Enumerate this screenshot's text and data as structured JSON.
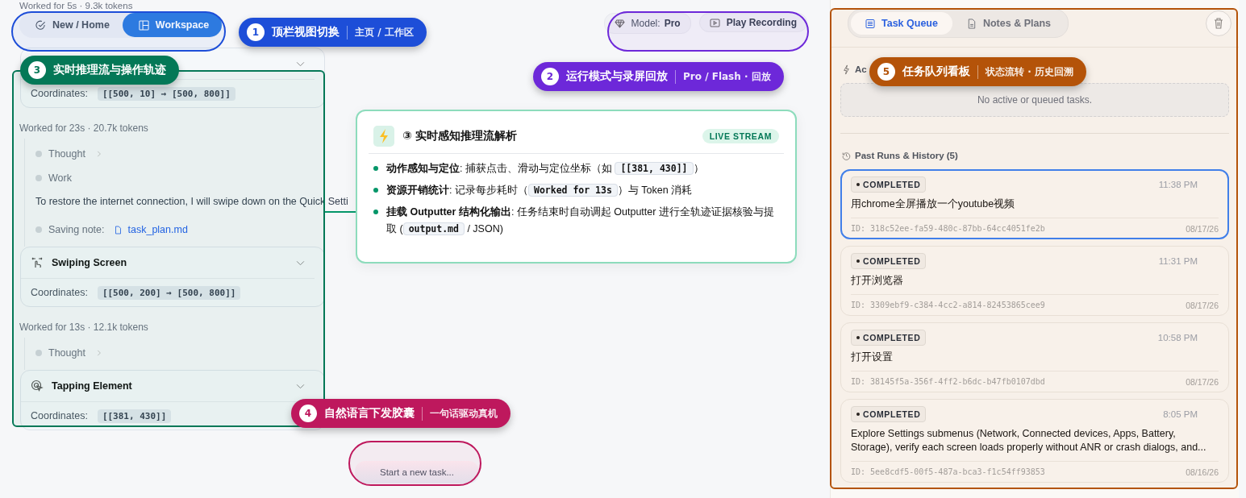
{
  "view_switch": {
    "tabs": [
      {
        "label": "New / Home",
        "selected": false
      },
      {
        "label": "Workspace",
        "selected": true
      }
    ]
  },
  "run_controls": {
    "model_label": "Model:",
    "model_value": "Pro",
    "play_label": "Play Recording"
  },
  "stream": [
    {
      "kind": "meta",
      "text": "Worked for 5s · 9.3k tokens"
    },
    {
      "kind": "action",
      "coords_label": "Coordinates:",
      "coords": "[[500, 10] → [500, 800]]"
    },
    {
      "kind": "meta",
      "text": "Worked for 23s · 20.7k tokens"
    },
    {
      "kind": "steps",
      "items": [
        {
          "kind": "step",
          "label": "Thought",
          "chevron": true
        },
        {
          "kind": "step",
          "label": "Work",
          "chevron": false
        },
        {
          "kind": "text",
          "text": "To restore the internet connection, I will swipe down on the Quick Setti"
        },
        {
          "kind": "note",
          "label": "Saving note:",
          "file": "task_plan.md"
        }
      ]
    },
    {
      "kind": "swipe_action",
      "title": "Swiping Screen",
      "coords_label": "Coordinates:",
      "coords": "[[500, 200] → [500, 800]]"
    },
    {
      "kind": "meta",
      "text": "Worked for 13s · 12.1k tokens"
    },
    {
      "kind": "steps",
      "items": [
        {
          "kind": "step",
          "label": "Thought",
          "chevron": true
        }
      ]
    },
    {
      "kind": "tap_action",
      "title": "Tapping Element",
      "coords_label": "Coordinates:",
      "coords": "[[381, 430]]"
    }
  ],
  "info_card": {
    "title": "③ 实时感知推理流解析",
    "badge": "LIVE STREAM",
    "bullets": [
      [
        {
          "kind": "text",
          "text": "**动作感知与定位**: 捕获点击、滑动与定位坐标（如 "
        },
        {
          "kind": "code",
          "text": "[[381, 430]]"
        },
        {
          "kind": "text",
          "text": "）"
        }
      ],
      [
        {
          "kind": "text",
          "text": "**资源开销统计**: 记录每步耗时（"
        },
        {
          "kind": "code",
          "text": "Worked for 13s"
        },
        {
          "kind": "text",
          "text": "）与 Token 消耗"
        }
      ],
      [
        {
          "kind": "text",
          "text": "**挂载 Outputter 结构化输出**: 任务结束时自动调起 Outputter 进行全轨迹证据核验与提取 ("
        },
        {
          "kind": "code",
          "text": "output.md"
        },
        {
          "kind": "text",
          "text": " / JSON)"
        }
      ]
    ]
  },
  "task_input": {
    "placeholder": "Start a new task..."
  },
  "panel": {
    "tabs": [
      {
        "label": "Task Queue",
        "selected": true
      },
      {
        "label": "Notes & Plans",
        "selected": false
      }
    ],
    "active_label": "Ac",
    "empty_text": "No active or queued tasks.",
    "history_title": "Past Runs & History (5)",
    "runs": [
      {
        "status": "COMPLETED",
        "time": "11:38 PM",
        "title": "用chrome全屏播放一个youtube视频",
        "id": "ID: 318c52ee-fa59-480c-87bb-64cc4051fe2b",
        "date": "08/17/26",
        "selected": true
      },
      {
        "status": "COMPLETED",
        "time": "11:31 PM",
        "title": "打开浏览器",
        "id": "ID: 3309ebf9-c384-4cc2-a814-82453865cee9",
        "date": "08/17/26",
        "selected": false
      },
      {
        "status": "COMPLETED",
        "time": "10:58 PM",
        "title": "打开设置",
        "id": "ID: 38145f5a-356f-4ff2-b6dc-b47fb0107dbd",
        "date": "08/17/26",
        "selected": false
      },
      {
        "status": "COMPLETED",
        "time": "8:05 PM",
        "title": "Explore Settings submenus (Network, Connected devices, Apps, Battery, Storage), verify each screen loads properly without ANR or crash dialogs, and...",
        "id": "ID: 5ee8cdf5-00f5-487a-bca3-f1c54ff93853",
        "date": "08/16/26",
        "selected": false
      }
    ]
  },
  "callouts": [
    {
      "number": "1",
      "title": "顶栏视图切换",
      "subtitle": "主页 / 工作区",
      "color": "#1d4ed8"
    },
    {
      "number": "2",
      "title": "运行模式与录屏回放",
      "subtitle": "Pro / Flash · 回放",
      "color": "#6d28d9"
    },
    {
      "number": "3",
      "title": "实时推理流与操作轨迹",
      "color": "#047857"
    },
    {
      "number": "4",
      "title": "自然语言下发胶囊",
      "subtitle": "一句话驱动真机",
      "color": "#be185d"
    },
    {
      "number": "5",
      "title": "任务队列看板",
      "subtitle": "状态流转 · 历史回溯",
      "color": "#b45309"
    }
  ]
}
